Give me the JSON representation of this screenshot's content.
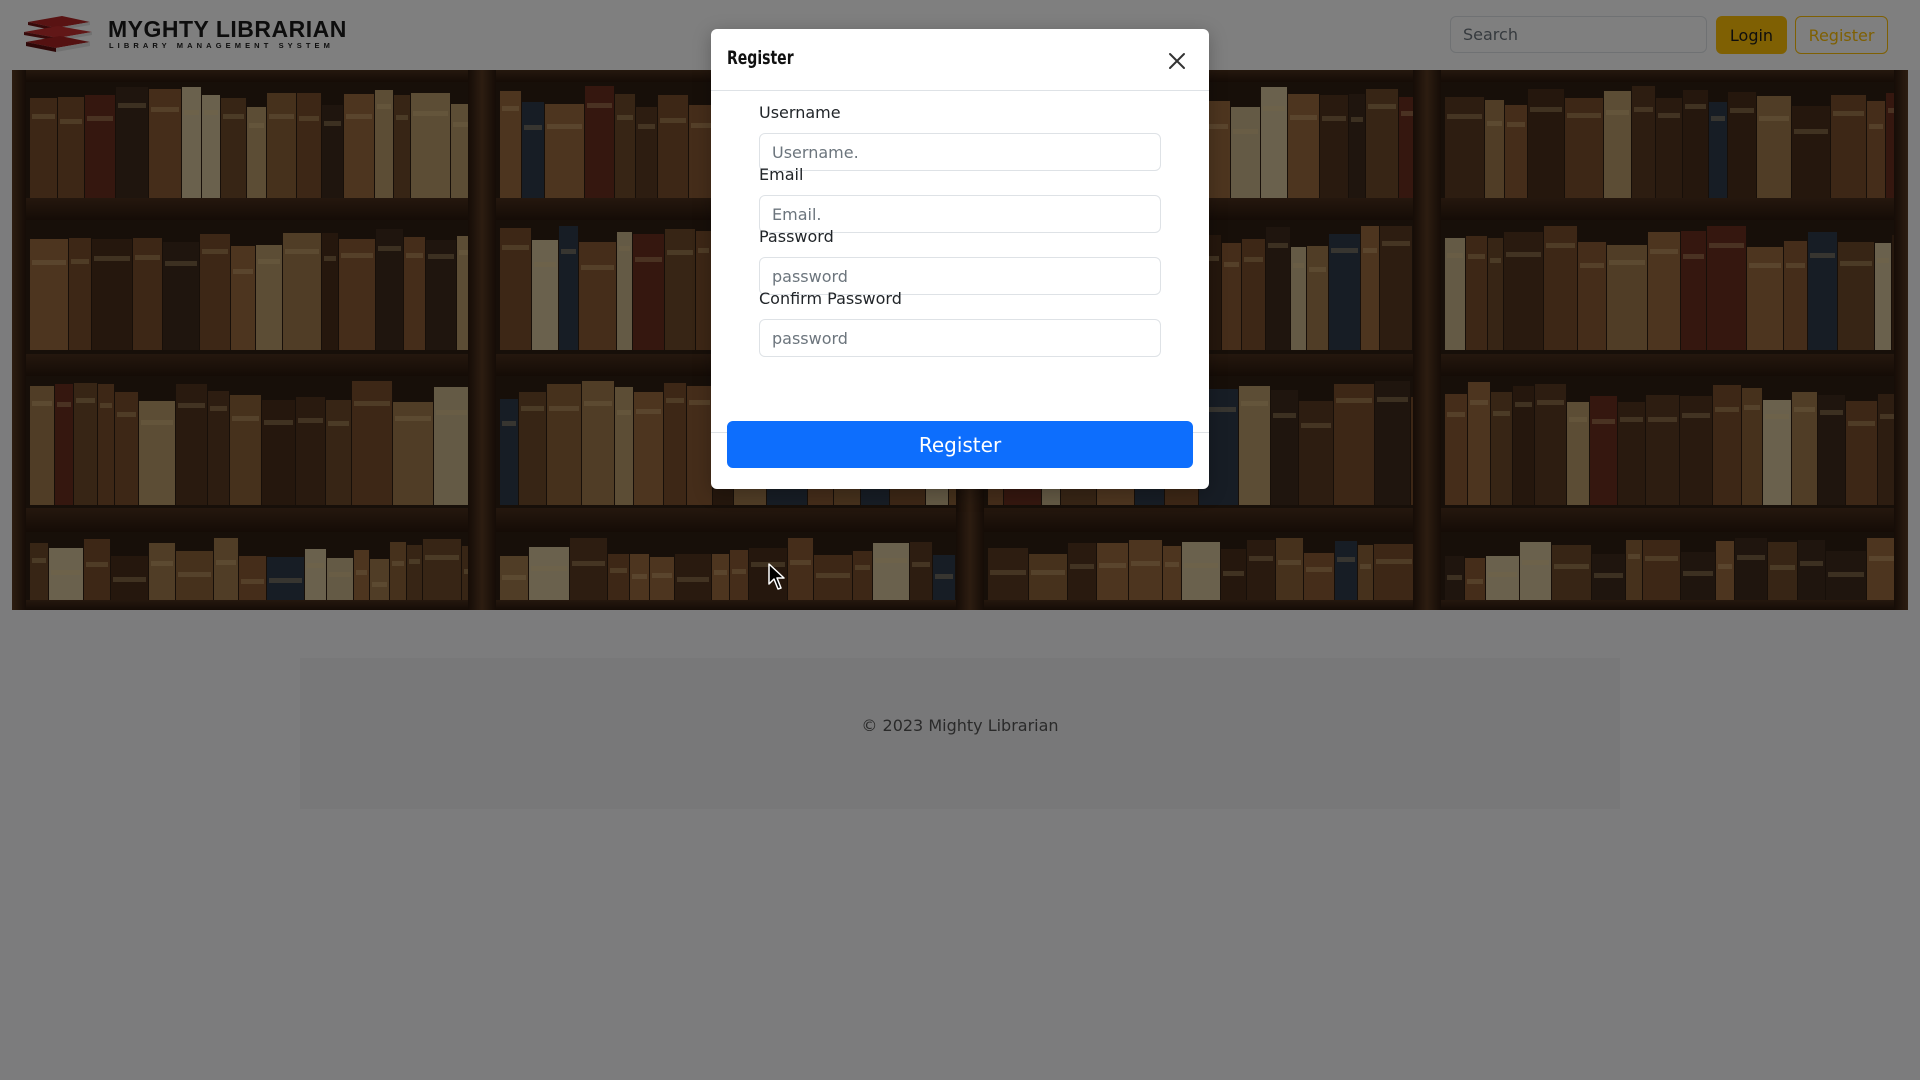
{
  "navbar": {
    "logo": {
      "title": "MYGHTY LIBRARIAN",
      "subtitle": "LIBRARY MANAGEMENT SYSTEM",
      "icon": "books-stack-logo-icon"
    },
    "search": {
      "placeholder": "Search",
      "value": ""
    },
    "login_label": "Login",
    "register_label": "Register",
    "colors": {
      "warning": "#ffc107"
    }
  },
  "footer": {
    "copyright": "© 2023 Mighty Librarian"
  },
  "modal": {
    "title": "Register",
    "close_icon": "close-icon",
    "fields": [
      {
        "label": "Username",
        "placeholder": "Username.",
        "value": ""
      },
      {
        "label": "Email",
        "placeholder": "Email.",
        "value": ""
      },
      {
        "label": "Password",
        "placeholder": "password",
        "value": ""
      },
      {
        "label": "Confirm Password",
        "placeholder": "password",
        "value": ""
      }
    ],
    "submit_label": "Register",
    "colors": {
      "primary": "#0d6efd"
    }
  }
}
